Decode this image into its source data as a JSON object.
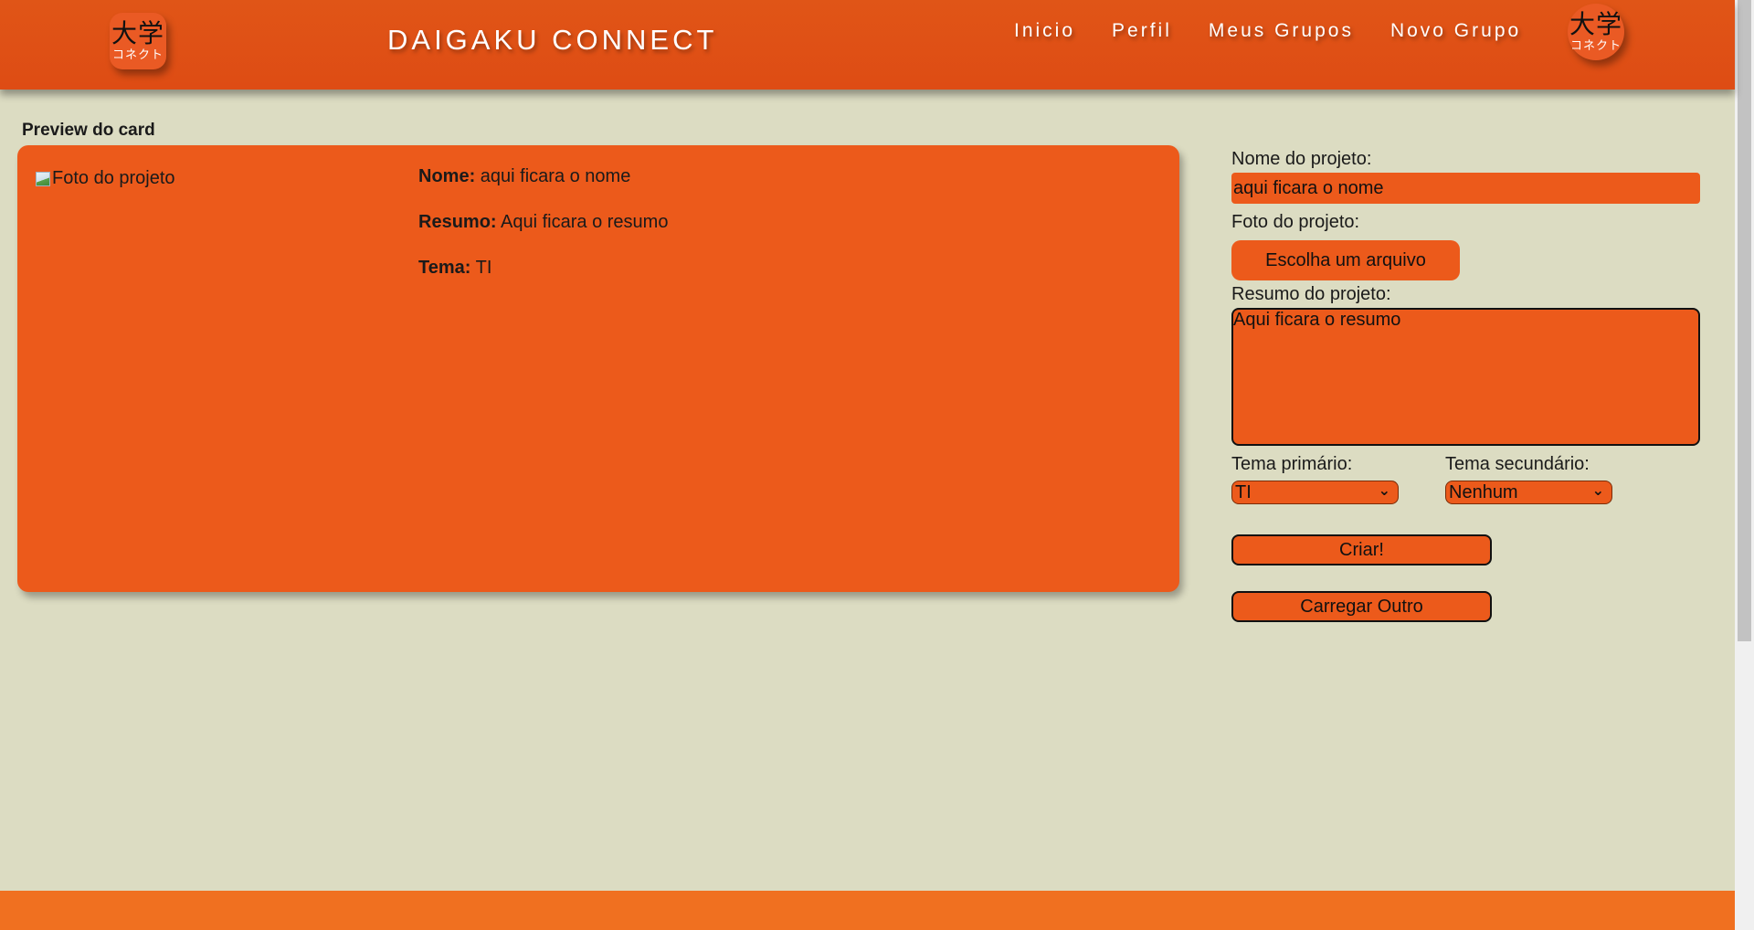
{
  "header": {
    "logo": {
      "kanji": "大学",
      "kana": "コネクト"
    },
    "brand": "DAIGAKU CONNECT",
    "nav": [
      "Inicio",
      "Perfil",
      "Meus Grupos",
      "Novo Grupo"
    ]
  },
  "preview": {
    "label": "Preview do card",
    "image_alt": "Foto do projeto",
    "fields": [
      {
        "label": "Nome:",
        "value": "aqui ficara o nome"
      },
      {
        "label": "Resumo:",
        "value": "Aqui ficara o resumo"
      },
      {
        "label": "Tema:",
        "value": "TI"
      }
    ]
  },
  "form": {
    "name_label": "Nome do projeto:",
    "name_value": "aqui ficara o nome",
    "photo_label": "Foto do projeto:",
    "file_button": "Escolha um arquivo",
    "summary_label": "Resumo do projeto:",
    "summary_value": "Aqui ficara o resumo",
    "primary_label": "Tema primário:",
    "primary_value": "TI",
    "secondary_label": "Tema secundário:",
    "secondary_value": "Nenhum",
    "create_button": "Criar!",
    "load_button": "Carregar Outro"
  },
  "colors": {
    "header": "#de4c14",
    "card": "#ec5a1b",
    "background": "#dcdcc2",
    "footer": "#f07020"
  },
  "icons": [
    "logo-icon",
    "broken-image-icon",
    "chevron-down-icon"
  ]
}
